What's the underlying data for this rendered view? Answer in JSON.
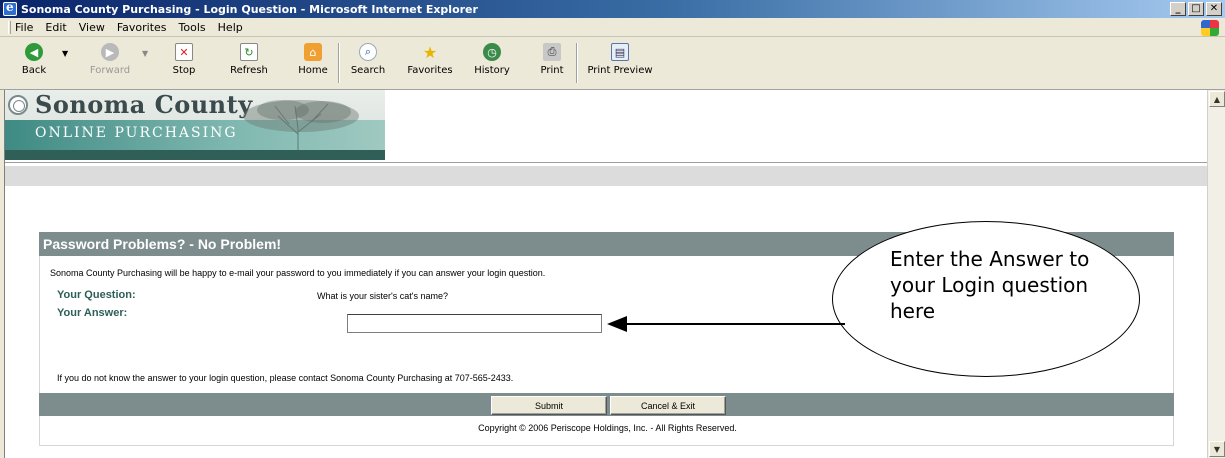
{
  "window": {
    "title": "Sonoma County Purchasing - Login Question - Microsoft Internet Explorer",
    "min": "_",
    "max": "□",
    "close": "✕"
  },
  "menu": [
    "File",
    "Edit",
    "View",
    "Favorites",
    "Tools",
    "Help"
  ],
  "toolbar": {
    "back": "Back",
    "forward": "Forward",
    "stop": "Stop",
    "refresh": "Refresh",
    "home": "Home",
    "search": "Search",
    "favorites": "Favorites",
    "history": "History",
    "print": "Print",
    "print_preview": "Print Preview"
  },
  "icons": {
    "back": "back-arrow-icon",
    "forward": "forward-arrow-icon",
    "stop": "stop-icon",
    "refresh": "refresh-icon",
    "home": "home-icon",
    "search": "search-icon",
    "favorites": "star-icon",
    "history": "history-icon",
    "print": "printer-icon",
    "print_preview": "print-preview-icon"
  },
  "banner": {
    "title": "Sonoma County",
    "subtitle": "ONLINE PURCHASING"
  },
  "panel": {
    "heading": "Password Problems? - No Problem!",
    "intro": "Sonoma County Purchasing will be happy to e-mail your password to you immediately if you can answer your login question.",
    "question_label": "Your Question:",
    "question_value": "What is your sister's cat's name?",
    "answer_label": "Your Answer:",
    "answer_value": "",
    "contact": "If you do not know the answer to your login question, please contact Sonoma County Purchasing at 707-565-2433.",
    "submit": "Submit",
    "cancel": "Cancel & Exit",
    "copyright": "Copyright © 2006 Periscope Holdings, Inc. - All Rights Reserved."
  },
  "callout": {
    "text": "Enter the Answer to your Login question here"
  },
  "colors": {
    "panel_header": "#7d8c8c",
    "label_teal": "#2e5e58",
    "banner_strip": "#3f8a84"
  }
}
